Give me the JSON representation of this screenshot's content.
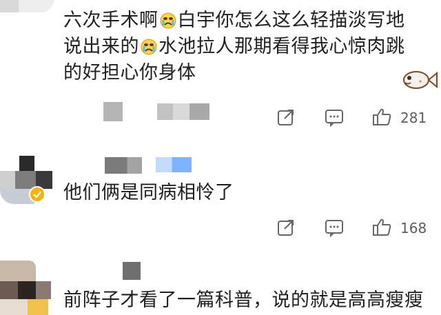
{
  "comments": [
    {
      "lines": [
        [
          "六次手术啊",
          "😭",
          "白宇你怎么这么轻描淡写地"
        ],
        [
          "说出来的",
          "😭",
          "水池拉人那期看得我心惊肉跳"
        ],
        [
          "的好担心你身体"
        ]
      ],
      "likes": "281"
    },
    {
      "lines": [
        [
          "他们俩是同病相怜了"
        ]
      ],
      "likes": "168",
      "verified_badge": true
    },
    {
      "lines": [
        [
          "前阵子才看了一篇科普，说的就是高高瘦瘦"
        ]
      ]
    }
  ],
  "icons": {
    "share": "share-square-icon",
    "comment": "comment-dots-icon",
    "like": "thumb-up-icon",
    "cry_emoji": "crying-face-emoji",
    "sticker": "fish-sticker-icon"
  },
  "colors": {
    "badge": "#ffb000",
    "text": "#1f1f1f",
    "icon": "#666666"
  }
}
